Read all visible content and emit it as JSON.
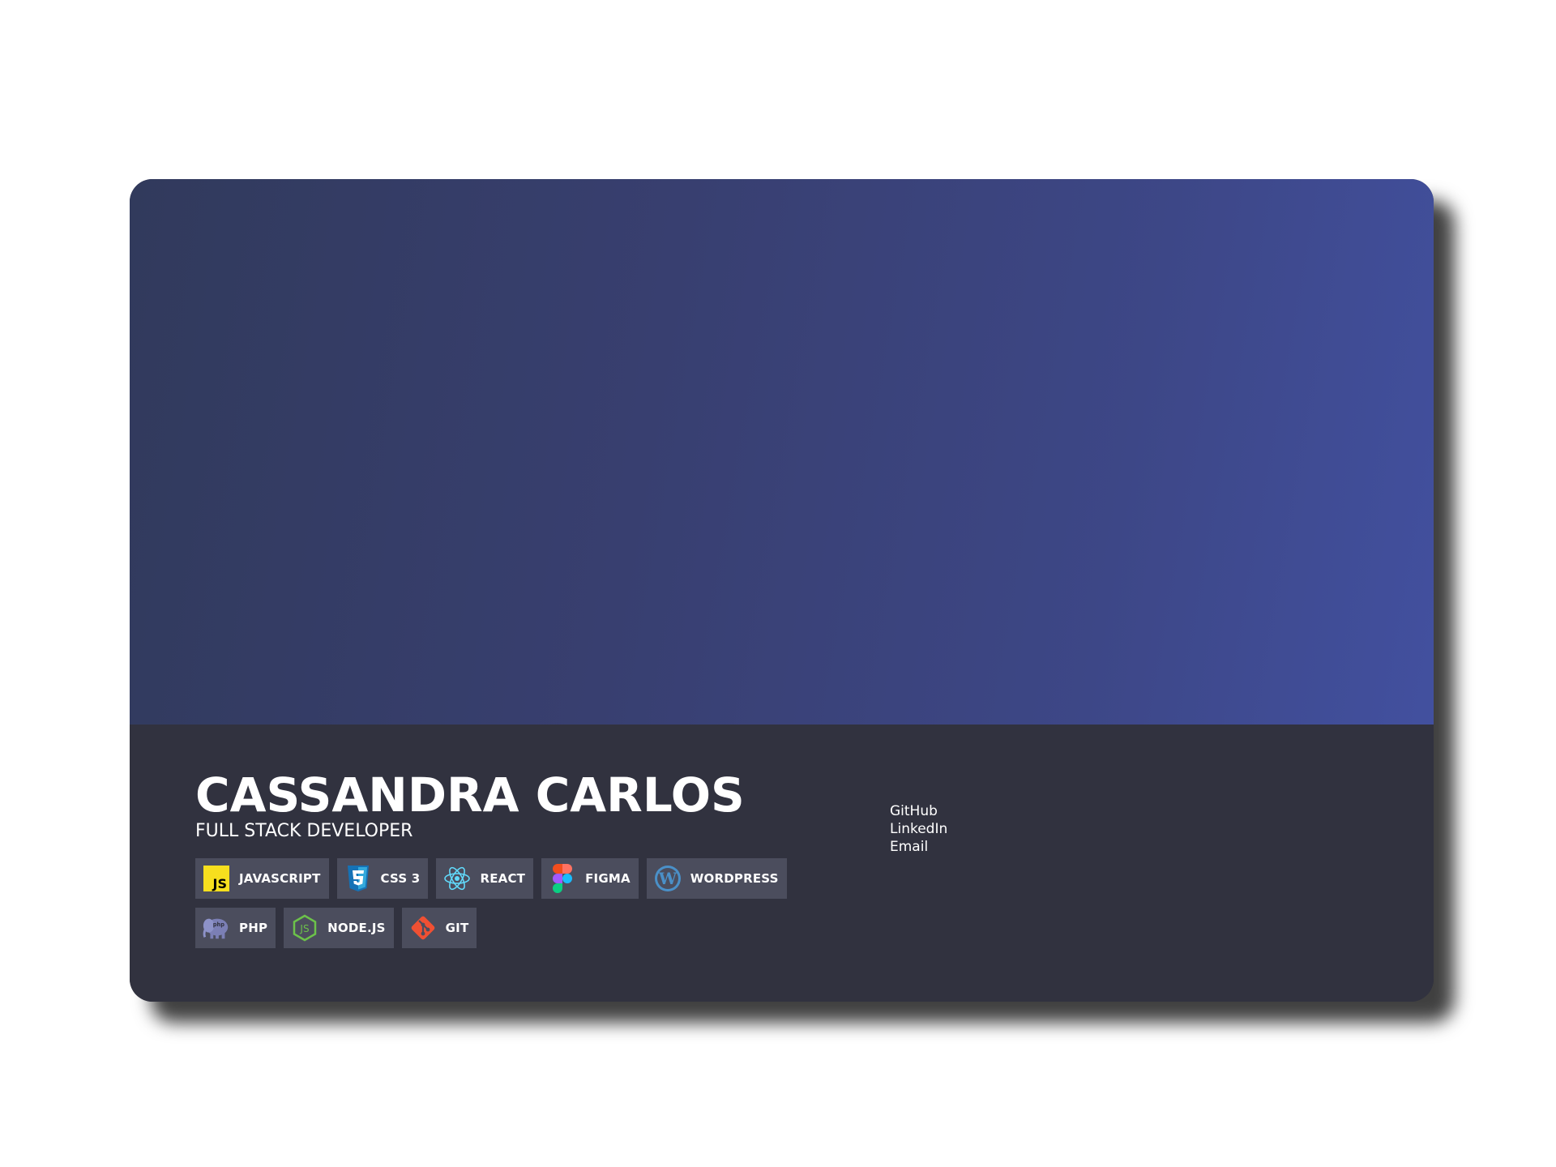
{
  "profile": {
    "name": "CASSANDRA CARLOS",
    "role": "FULL STACK DEVELOPER"
  },
  "skills_row1": [
    {
      "label": "JAVASCRIPT",
      "icon": "javascript-icon"
    },
    {
      "label": "CSS 3",
      "icon": "css3-icon"
    },
    {
      "label": "REACT",
      "icon": "react-icon"
    },
    {
      "label": "FIGMA",
      "icon": "figma-icon"
    },
    {
      "label": "WORDPRESS",
      "icon": "wordpress-icon"
    }
  ],
  "skills_row2": [
    {
      "label": "PHP",
      "icon": "php-icon"
    },
    {
      "label": "NODE.JS",
      "icon": "nodejs-icon"
    },
    {
      "label": "GIT",
      "icon": "git-icon"
    }
  ],
  "links": [
    "GitHub",
    "LinkedIn",
    "Email"
  ],
  "colors": {
    "banner_start": "#313a5c",
    "banner_end": "#42509f",
    "info_bg": "#31323f",
    "chip_bg": "#4b4d5d"
  }
}
